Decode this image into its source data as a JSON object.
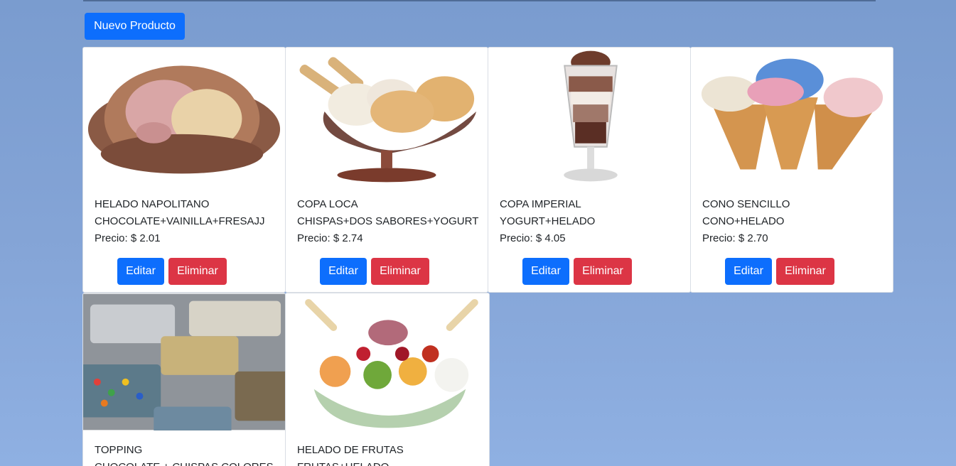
{
  "toolbar": {
    "new_product_label": "Nuevo Producto"
  },
  "products": [
    {
      "name": "HELADO NAPOLITANO",
      "description": "CHOCOLATE+VAINILLA+FRESAJJ",
      "price": "Precio: $ 2.01",
      "edit_label": "Editar",
      "delete_label": "Eliminar",
      "image": "neapolitan-ice-cream-scoop"
    },
    {
      "name": "COPA LOCA",
      "description": "CHISPAS+DOS SABORES+YOGURT",
      "price": "Precio: $ 2.74",
      "edit_label": "Editar",
      "delete_label": "Eliminar",
      "image": "ice-cream-sundae-cup"
    },
    {
      "name": "COPA IMPERIAL",
      "description": "YOGURT+HELADO",
      "price": "Precio: $ 4.05",
      "edit_label": "Editar",
      "delete_label": "Eliminar",
      "image": "parfait-glass"
    },
    {
      "name": "CONO SENCILLO",
      "description": "CONO+HELADO",
      "price": "Precio: $ 2.70",
      "edit_label": "Editar",
      "delete_label": "Eliminar",
      "image": "ice-cream-cones"
    },
    {
      "name": "TOPPING",
      "description": "CHOCOLATE + CHISPAS COLORES",
      "price": "",
      "image": "topping-trays"
    },
    {
      "name": "HELADO DE FRUTAS",
      "description": "FRUTAS+HELADO",
      "price": "",
      "image": "fruit-ice-cream-bowl"
    }
  ]
}
